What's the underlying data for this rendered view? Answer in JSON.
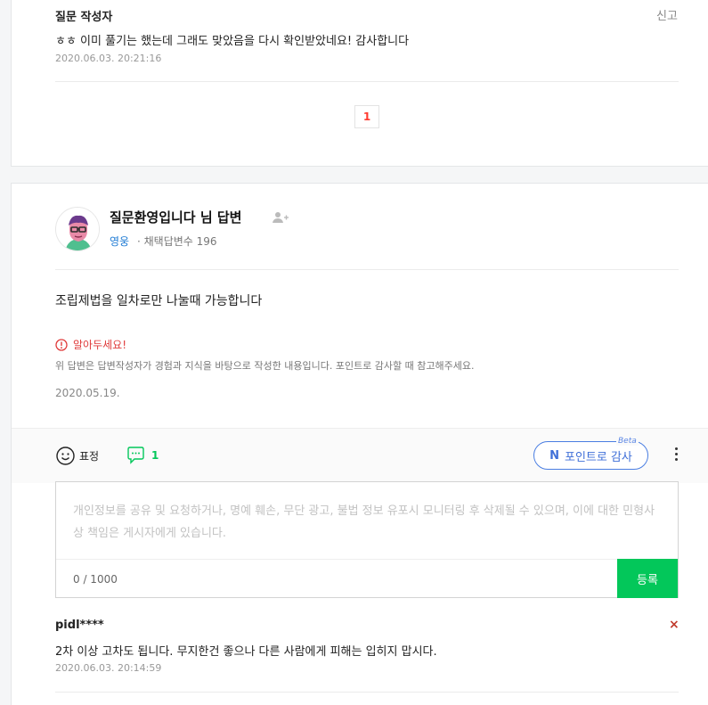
{
  "question_comment": {
    "author": "질문 작성자",
    "report_label": "신고",
    "text": "ㅎㅎ 이미 풀기는 했는데 그래도 맞았음을 다시 확인받았네요! 감사합니다",
    "date": "2020.06.03. 20:21:16"
  },
  "pagination": {
    "current_page": "1"
  },
  "answer": {
    "title": "질문환영입니다 님 답변",
    "rank": "영웅",
    "adopted_count_label": "· 채택답변수 196",
    "body": "조립제법을 일차로만 나눌때 가능합니다",
    "notice_title": "알아두세요!",
    "notice_text": "위 답변은 답변작성자가 경험과 지식을 바탕으로 작성한 내용입니다. 포인트로 감사할 때 참고해주세요.",
    "date": "2020.05.19."
  },
  "actions": {
    "reaction_label": "표정",
    "comment_count": "1",
    "point_thanks_label": "포인트로 감사",
    "point_icon_letter": "N",
    "beta_label": "Beta"
  },
  "comment_form": {
    "placeholder": "개인정보를 공유 및 요청하거나, 명예 훼손, 무단 광고, 불법 정보 유포시 모니터링 후 삭제될 수 있으며, 이에 대한 민형사상 책임은 게시자에게 있습니다.",
    "counter": "0 / 1000",
    "submit_label": "등록"
  },
  "reply": {
    "author": "pidl****",
    "delete_label": "×",
    "text": "2차 이상 고차도 됩니다. 무지한건 좋으나 다른 사람에게 피해는 입히지 맙시다.",
    "date": "2020.06.03. 20:14:59"
  },
  "colors": {
    "accent_green": "#03c75a",
    "accent_blue": "#3f6fd8",
    "warning_red": "#e03b3b",
    "rank_blue": "#1f7bd4"
  }
}
